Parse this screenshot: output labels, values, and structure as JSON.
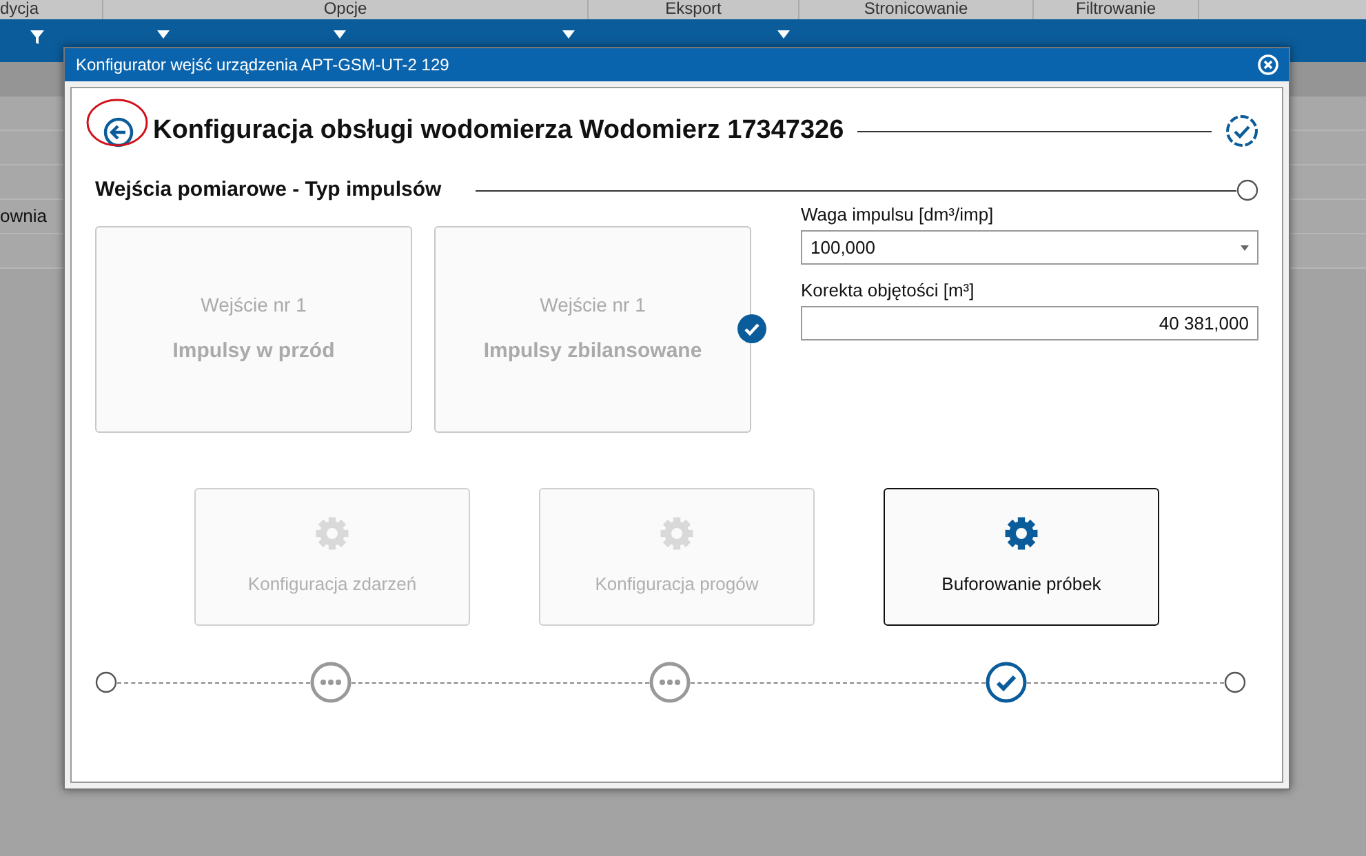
{
  "background": {
    "ribbon_groups": [
      "dycja",
      "Opcje",
      "Eksport",
      "Stronicowanie",
      "Filtrowanie"
    ],
    "rows": [
      {
        "column_1": "ownia"
      }
    ]
  },
  "dialog": {
    "title": "Konfigurator wejść urządzenia APT-GSM-UT-2 129",
    "header": {
      "title": "Konfiguracja obsługi wodomierza Wodomierz 17347326",
      "back_highlighted": true
    },
    "section": {
      "title": "Wejścia pomiarowe - Typ impulsów"
    },
    "input_types": [
      {
        "caption": "Wejście nr 1",
        "label": "Impulsy w przód",
        "selected": false
      },
      {
        "caption": "Wejście nr 1",
        "label": "Impulsy zbilansowane",
        "selected": true
      }
    ],
    "fields": [
      {
        "kind": "select",
        "label": "Waga impulsu [dm³/imp]",
        "value": "100,000"
      },
      {
        "kind": "text",
        "label": "Korekta objętości [m³]",
        "value": "40 381,000"
      }
    ],
    "actions": [
      {
        "label": "Konfiguracja zdarzeń",
        "disabled": true
      },
      {
        "label": "Konfiguracja progów",
        "disabled": true
      },
      {
        "label": "Buforowanie próbek",
        "disabled": false
      }
    ],
    "steps": [
      {
        "completed": false
      },
      {
        "completed": false
      },
      {
        "completed": true
      }
    ]
  }
}
